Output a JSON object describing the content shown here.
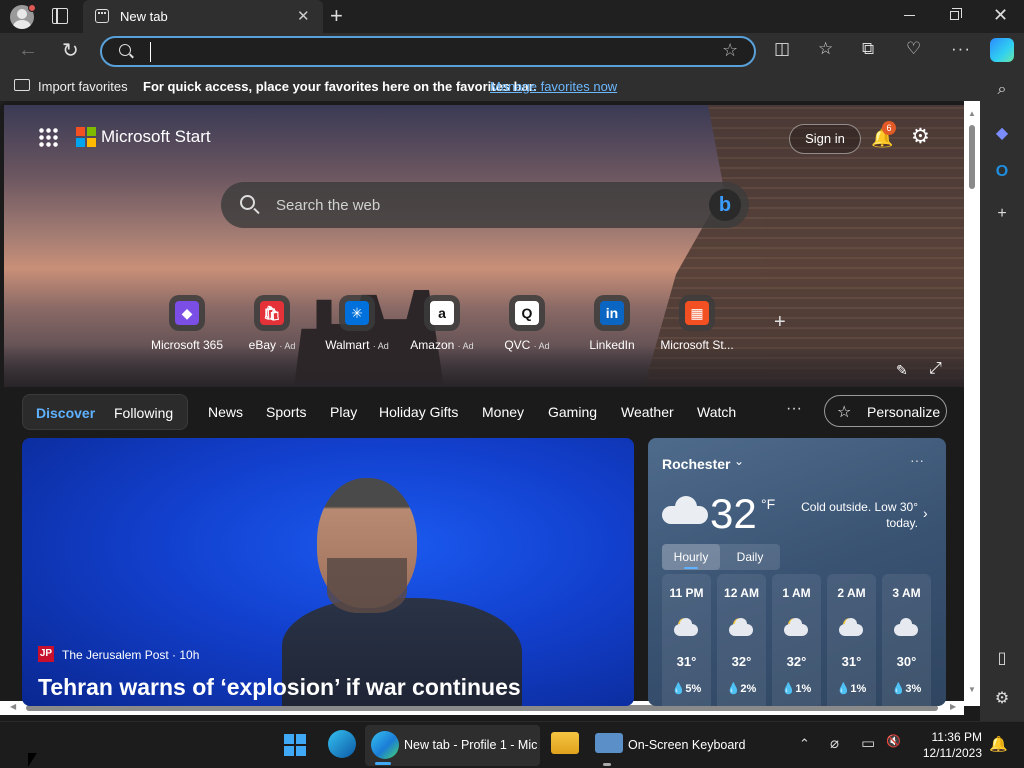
{
  "browser": {
    "tab_title": "New tab",
    "address_value": "",
    "icons": {
      "profile": "profile-avatar-icon",
      "tab_actions": "tab-actions-icon",
      "new_tab": "plus-icon",
      "back": "back-arrow-icon",
      "refresh": "refresh-icon",
      "favorite": "star-icon",
      "split_screen": "split-screen-icon",
      "favorites": "favorites-icon",
      "collections": "collections-icon",
      "browser_essentials": "heart-pulse-icon",
      "more": "more-icon",
      "copilot": "copilot-icon"
    }
  },
  "favorites_bar": {
    "import_label": "Import favorites",
    "message": "For quick access, place your favorites here on the favorites bar.",
    "manage_link": "Manage favorites now"
  },
  "sidebar": {
    "items": [
      "search-icon",
      "copilot-icon",
      "outlook-icon",
      "add-icon",
      "split-pane-icon",
      "settings-icon"
    ]
  },
  "start": {
    "brand": "Microsoft Start",
    "sign_in": "Sign in",
    "notifications_count": "6",
    "search_placeholder": "Search the web",
    "quick_links": [
      {
        "label": "Microsoft 365",
        "ad": "",
        "color": "#7b4ee6"
      },
      {
        "label": "eBay",
        "ad": "· Ad",
        "color": "#e53238"
      },
      {
        "label": "Walmart",
        "ad": "· Ad",
        "color": "#0071dc"
      },
      {
        "label": "Amazon",
        "ad": "· Ad",
        "color": "#ffffff"
      },
      {
        "label": "QVC",
        "ad": "· Ad",
        "color": "#ffffff"
      },
      {
        "label": "LinkedIn",
        "ad": "",
        "color": "#0a66c2"
      },
      {
        "label": "Microsoft St...",
        "ad": "",
        "color": "#f25022"
      }
    ]
  },
  "feed_nav": {
    "discover": "Discover",
    "following": "Following",
    "items": [
      "News",
      "Sports",
      "Play",
      "Holiday Gifts",
      "Money",
      "Gaming",
      "Weather",
      "Watch"
    ],
    "more": "···",
    "personalize": "Personalize"
  },
  "news": {
    "source": "The Jerusalem Post · 10h",
    "source_logo": "JP",
    "headline": "Tehran warns of ‘explosion’ if war continues"
  },
  "weather": {
    "location": "Rochester",
    "temp": "32",
    "unit": "°F",
    "note": "Cold outside. Low 30° today.",
    "tab_hourly": "Hourly",
    "tab_daily": "Daily",
    "hours": [
      {
        "time": "11 PM",
        "temp": "31°",
        "precip": "💧5%",
        "icon": "partly-cloudy-night-icon"
      },
      {
        "time": "12 AM",
        "temp": "32°",
        "precip": "💧2%",
        "icon": "partly-cloudy-night-icon"
      },
      {
        "time": "1 AM",
        "temp": "32°",
        "precip": "💧1%",
        "icon": "partly-cloudy-night-icon"
      },
      {
        "time": "2 AM",
        "temp": "31°",
        "precip": "💧1%",
        "icon": "partly-cloudy-night-icon"
      },
      {
        "time": "3 AM",
        "temp": "30°",
        "precip": "💧3%",
        "icon": "cloudy-icon"
      }
    ]
  },
  "taskbar": {
    "edge_label": "New tab - Profile 1 - Mic",
    "keyboard_label": "On-Screen Keyboard",
    "time": "11:36 PM",
    "date": "12/11/2023",
    "accent": "#3fa9f5"
  }
}
